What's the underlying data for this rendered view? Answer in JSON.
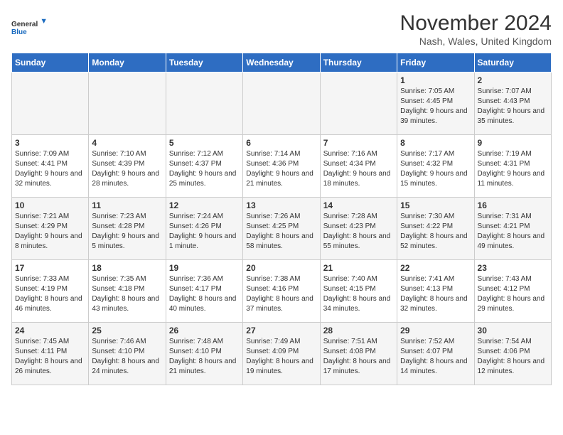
{
  "logo": {
    "text_general": "General",
    "text_blue": "Blue"
  },
  "title": "November 2024",
  "location": "Nash, Wales, United Kingdom",
  "days_of_week": [
    "Sunday",
    "Monday",
    "Tuesday",
    "Wednesday",
    "Thursday",
    "Friday",
    "Saturday"
  ],
  "weeks": [
    [
      {
        "day": "",
        "info": ""
      },
      {
        "day": "",
        "info": ""
      },
      {
        "day": "",
        "info": ""
      },
      {
        "day": "",
        "info": ""
      },
      {
        "day": "",
        "info": ""
      },
      {
        "day": "1",
        "info": "Sunrise: 7:05 AM\nSunset: 4:45 PM\nDaylight: 9 hours and 39 minutes."
      },
      {
        "day": "2",
        "info": "Sunrise: 7:07 AM\nSunset: 4:43 PM\nDaylight: 9 hours and 35 minutes."
      }
    ],
    [
      {
        "day": "3",
        "info": "Sunrise: 7:09 AM\nSunset: 4:41 PM\nDaylight: 9 hours and 32 minutes."
      },
      {
        "day": "4",
        "info": "Sunrise: 7:10 AM\nSunset: 4:39 PM\nDaylight: 9 hours and 28 minutes."
      },
      {
        "day": "5",
        "info": "Sunrise: 7:12 AM\nSunset: 4:37 PM\nDaylight: 9 hours and 25 minutes."
      },
      {
        "day": "6",
        "info": "Sunrise: 7:14 AM\nSunset: 4:36 PM\nDaylight: 9 hours and 21 minutes."
      },
      {
        "day": "7",
        "info": "Sunrise: 7:16 AM\nSunset: 4:34 PM\nDaylight: 9 hours and 18 minutes."
      },
      {
        "day": "8",
        "info": "Sunrise: 7:17 AM\nSunset: 4:32 PM\nDaylight: 9 hours and 15 minutes."
      },
      {
        "day": "9",
        "info": "Sunrise: 7:19 AM\nSunset: 4:31 PM\nDaylight: 9 hours and 11 minutes."
      }
    ],
    [
      {
        "day": "10",
        "info": "Sunrise: 7:21 AM\nSunset: 4:29 PM\nDaylight: 9 hours and 8 minutes."
      },
      {
        "day": "11",
        "info": "Sunrise: 7:23 AM\nSunset: 4:28 PM\nDaylight: 9 hours and 5 minutes."
      },
      {
        "day": "12",
        "info": "Sunrise: 7:24 AM\nSunset: 4:26 PM\nDaylight: 9 hours and 1 minute."
      },
      {
        "day": "13",
        "info": "Sunrise: 7:26 AM\nSunset: 4:25 PM\nDaylight: 8 hours and 58 minutes."
      },
      {
        "day": "14",
        "info": "Sunrise: 7:28 AM\nSunset: 4:23 PM\nDaylight: 8 hours and 55 minutes."
      },
      {
        "day": "15",
        "info": "Sunrise: 7:30 AM\nSunset: 4:22 PM\nDaylight: 8 hours and 52 minutes."
      },
      {
        "day": "16",
        "info": "Sunrise: 7:31 AM\nSunset: 4:21 PM\nDaylight: 8 hours and 49 minutes."
      }
    ],
    [
      {
        "day": "17",
        "info": "Sunrise: 7:33 AM\nSunset: 4:19 PM\nDaylight: 8 hours and 46 minutes."
      },
      {
        "day": "18",
        "info": "Sunrise: 7:35 AM\nSunset: 4:18 PM\nDaylight: 8 hours and 43 minutes."
      },
      {
        "day": "19",
        "info": "Sunrise: 7:36 AM\nSunset: 4:17 PM\nDaylight: 8 hours and 40 minutes."
      },
      {
        "day": "20",
        "info": "Sunrise: 7:38 AM\nSunset: 4:16 PM\nDaylight: 8 hours and 37 minutes."
      },
      {
        "day": "21",
        "info": "Sunrise: 7:40 AM\nSunset: 4:15 PM\nDaylight: 8 hours and 34 minutes."
      },
      {
        "day": "22",
        "info": "Sunrise: 7:41 AM\nSunset: 4:13 PM\nDaylight: 8 hours and 32 minutes."
      },
      {
        "day": "23",
        "info": "Sunrise: 7:43 AM\nSunset: 4:12 PM\nDaylight: 8 hours and 29 minutes."
      }
    ],
    [
      {
        "day": "24",
        "info": "Sunrise: 7:45 AM\nSunset: 4:11 PM\nDaylight: 8 hours and 26 minutes."
      },
      {
        "day": "25",
        "info": "Sunrise: 7:46 AM\nSunset: 4:10 PM\nDaylight: 8 hours and 24 minutes."
      },
      {
        "day": "26",
        "info": "Sunrise: 7:48 AM\nSunset: 4:10 PM\nDaylight: 8 hours and 21 minutes."
      },
      {
        "day": "27",
        "info": "Sunrise: 7:49 AM\nSunset: 4:09 PM\nDaylight: 8 hours and 19 minutes."
      },
      {
        "day": "28",
        "info": "Sunrise: 7:51 AM\nSunset: 4:08 PM\nDaylight: 8 hours and 17 minutes."
      },
      {
        "day": "29",
        "info": "Sunrise: 7:52 AM\nSunset: 4:07 PM\nDaylight: 8 hours and 14 minutes."
      },
      {
        "day": "30",
        "info": "Sunrise: 7:54 AM\nSunset: 4:06 PM\nDaylight: 8 hours and 12 minutes."
      }
    ]
  ]
}
